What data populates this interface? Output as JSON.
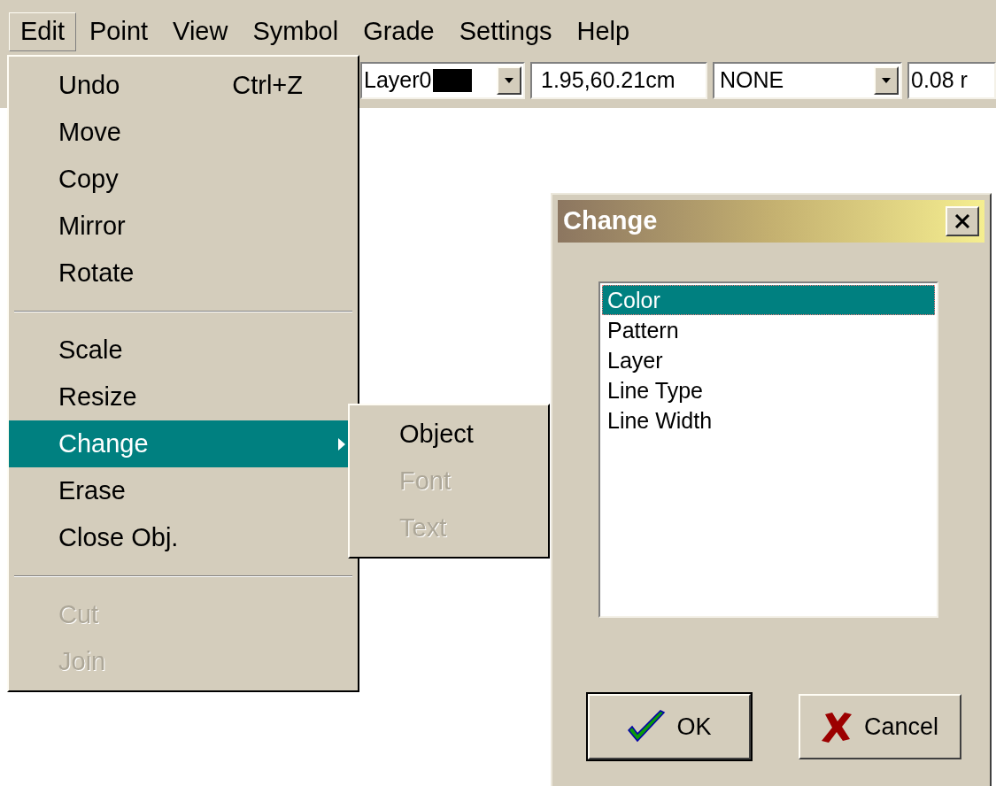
{
  "menu_bar": [
    {
      "label": "Edit",
      "selected": true
    },
    {
      "label": "Point",
      "selected": false
    },
    {
      "label": "View",
      "selected": false
    },
    {
      "label": "Symbol",
      "selected": false
    },
    {
      "label": "Grade",
      "selected": false
    },
    {
      "label": "Settings",
      "selected": false
    },
    {
      "label": "Help",
      "selected": false
    }
  ],
  "toolbar": {
    "layer_combo": {
      "value": "Layer0",
      "color": "#000000"
    },
    "coordinates": "1.95,60.21cm",
    "pattern_combo": {
      "value": "NONE"
    },
    "width_field": "0.08 r"
  },
  "edit_menu": [
    {
      "kind": "item",
      "label": "Undo",
      "shortcut": "Ctrl+Z",
      "disabled": false,
      "selected": false
    },
    {
      "kind": "item",
      "label": "Move",
      "disabled": false,
      "selected": false
    },
    {
      "kind": "item",
      "label": "Copy",
      "disabled": false,
      "selected": false
    },
    {
      "kind": "item",
      "label": "Mirror",
      "disabled": false,
      "selected": false
    },
    {
      "kind": "item",
      "label": "Rotate",
      "disabled": false,
      "selected": false
    },
    {
      "kind": "separator"
    },
    {
      "kind": "item",
      "label": "Scale",
      "disabled": false,
      "selected": false
    },
    {
      "kind": "item",
      "label": "Resize",
      "disabled": false,
      "selected": false
    },
    {
      "kind": "submenu",
      "label": "Change",
      "disabled": false,
      "selected": true
    },
    {
      "kind": "item",
      "label": "Erase",
      "disabled": false,
      "selected": false
    },
    {
      "kind": "item",
      "label": "Close Obj.",
      "disabled": false,
      "selected": false
    },
    {
      "kind": "separator"
    },
    {
      "kind": "item",
      "label": "Cut",
      "disabled": true,
      "selected": false
    },
    {
      "kind": "item",
      "label": "Join",
      "disabled": true,
      "selected": false
    }
  ],
  "change_submenu": [
    {
      "label": "Object",
      "disabled": false
    },
    {
      "label": "Font",
      "disabled": true
    },
    {
      "label": "Text",
      "disabled": true
    }
  ],
  "dialog": {
    "title": "Change",
    "list": [
      {
        "label": "Color",
        "selected": true
      },
      {
        "label": "Pattern",
        "selected": false
      },
      {
        "label": "Layer",
        "selected": false
      },
      {
        "label": "Line Type",
        "selected": false
      },
      {
        "label": "Line Width",
        "selected": false
      }
    ],
    "buttons": [
      {
        "kind": "ok",
        "label": "OK",
        "default": true
      },
      {
        "kind": "cancel",
        "label": "Cancel",
        "default": false
      }
    ]
  }
}
